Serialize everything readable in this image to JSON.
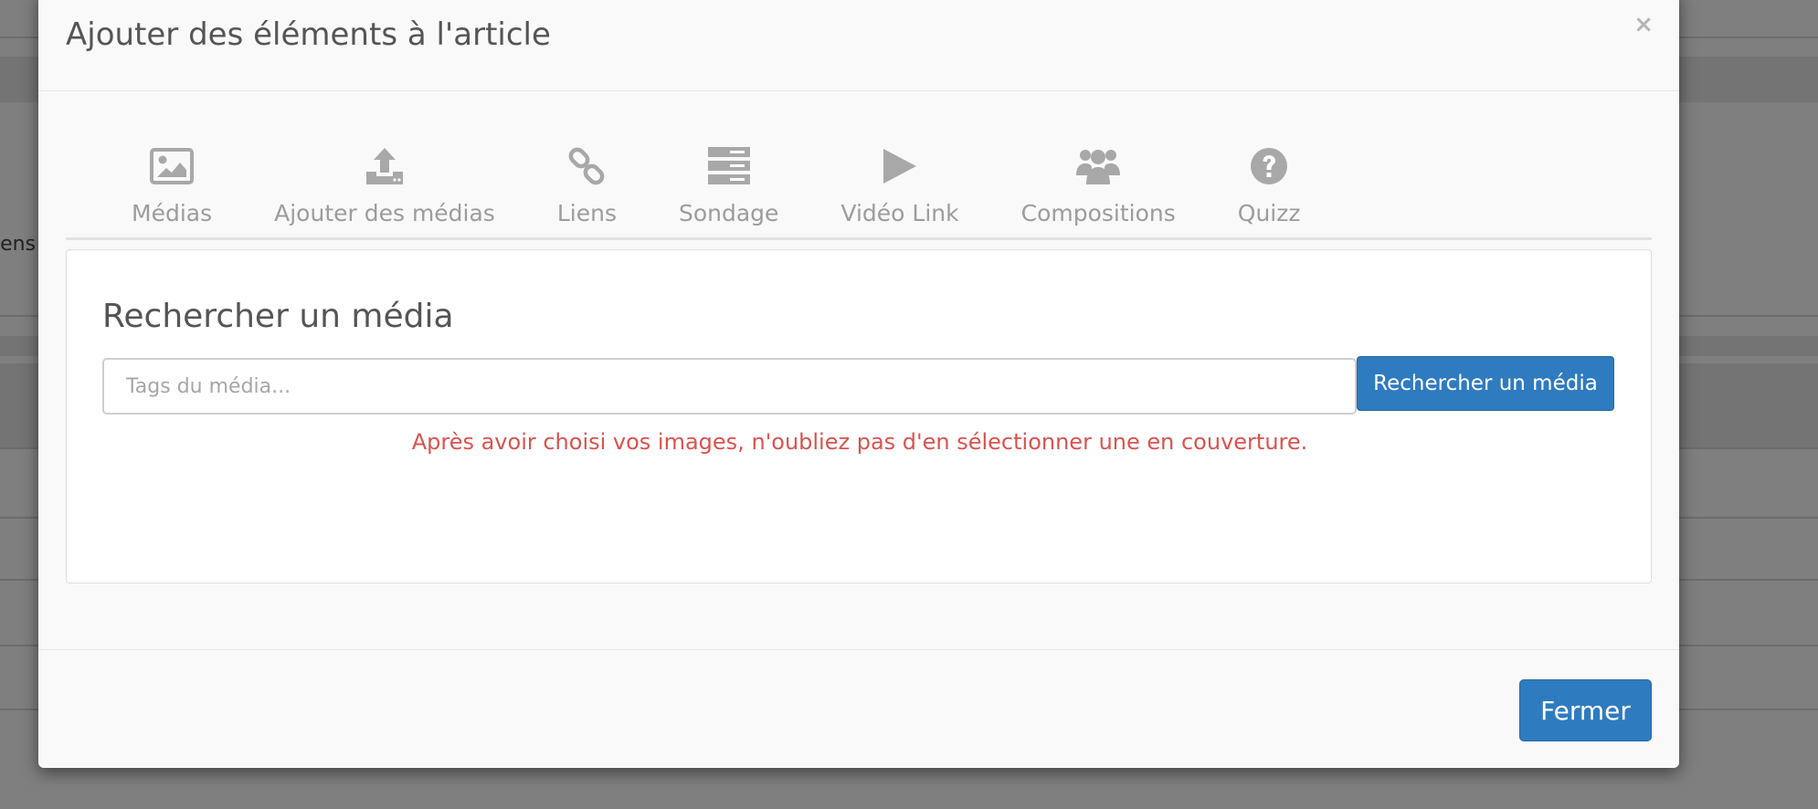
{
  "background": {
    "partial_text": "iens"
  },
  "modal": {
    "title": "Ajouter des éléments à l'article",
    "close_symbol": "×",
    "tabs": [
      {
        "label": "Médias",
        "icon": "image-icon"
      },
      {
        "label": "Ajouter des médias",
        "icon": "upload-icon"
      },
      {
        "label": "Liens",
        "icon": "link-icon"
      },
      {
        "label": "Sondage",
        "icon": "server-icon"
      },
      {
        "label": "Vidéo Link",
        "icon": "play-icon"
      },
      {
        "label": "Compositions",
        "icon": "users-icon"
      },
      {
        "label": "Quizz",
        "icon": "question-circle-icon"
      }
    ],
    "search": {
      "title": "Rechercher un média",
      "placeholder": "Tags du média...",
      "value": "",
      "button_label": "Rechercher un média",
      "hint": "Après avoir choisi vos images, n'oubliez pas d'en sélectionner une en couverture."
    },
    "footer": {
      "close_label": "Fermer"
    }
  },
  "colors": {
    "primary": "#2f7bc0",
    "danger_text": "#d9534f",
    "tab_icon": "#a8a8a8"
  }
}
